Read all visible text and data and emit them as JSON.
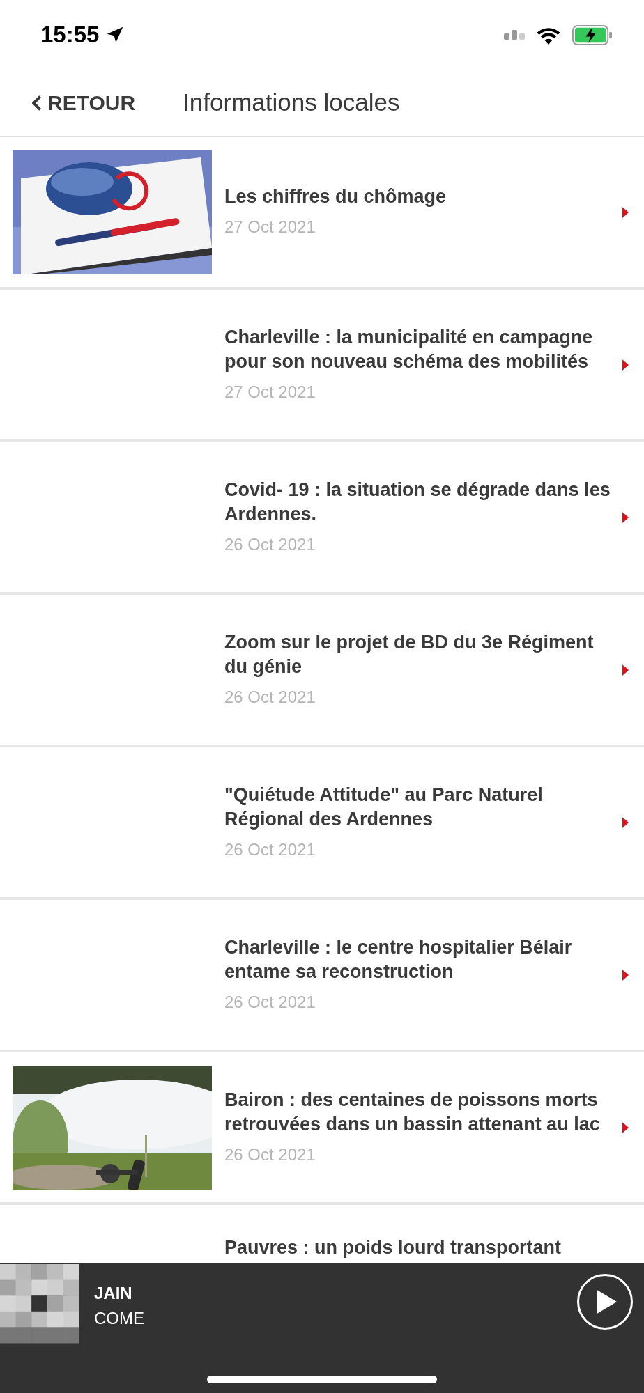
{
  "status_bar": {
    "time": "15:55"
  },
  "nav": {
    "back": "RETOUR",
    "title": "Informations locales"
  },
  "articles": [
    {
      "title": "Les chiffres du chômage",
      "date": "27 Oct 2021"
    },
    {
      "title": "Charleville : la municipalité en campagne pour son nouveau schéma des mobilités",
      "date": "27 Oct 2021"
    },
    {
      "title": "Covid- 19 : la situation se dégrade dans les Ardennes.",
      "date": "26 Oct 2021"
    },
    {
      "title": "Zoom sur le projet de BD du 3e Régiment du génie",
      "date": "26 Oct 2021"
    },
    {
      "title": "\"Quiétude Attitude\" au Parc Naturel Régional des Ardennes",
      "date": "26 Oct 2021"
    },
    {
      "title": "Charleville : le centre hospitalier Bélair entame sa reconstruction",
      "date": "26 Oct 2021"
    },
    {
      "title": "Bairon : des centaines de poissons morts retrouvées dans un bassin attenant au lac",
      "date": "26 Oct 2021"
    },
    {
      "title": "Pauvres : un poids lourd transportant"
    }
  ],
  "player": {
    "artist": "JAIN",
    "track": "COME"
  }
}
